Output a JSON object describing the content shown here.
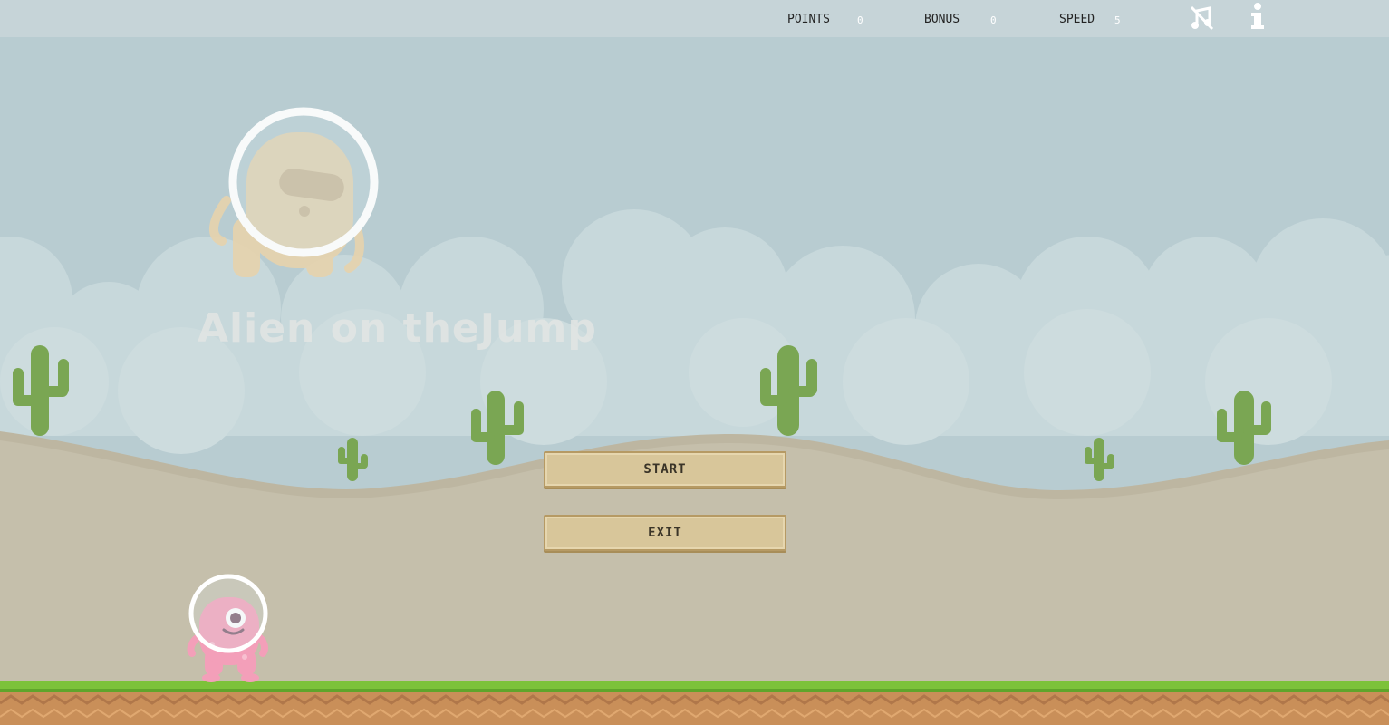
{
  "hud": {
    "points_label": "POINTS",
    "points_value": "0",
    "bonus_label": "BONUS",
    "bonus_value": "0",
    "speed_label": "SPEED",
    "speed_value": "5",
    "music_icon": "music-muted-icon",
    "info_icon": "info-icon"
  },
  "title": {
    "text": "Alien on theJump"
  },
  "menu": {
    "start_label": "START",
    "exit_label": "EXIT"
  },
  "colors": {
    "sky": "#b8ccd1",
    "hud_bar": "#c6d4d8",
    "cloud": "#c7d8db",
    "dune": "#c5bfab",
    "cactus": "#7aa653",
    "grass": "#7cc23a",
    "dirt": "#c98f59",
    "button": "#d8c69a",
    "alien_pink": "#f39fb9"
  }
}
